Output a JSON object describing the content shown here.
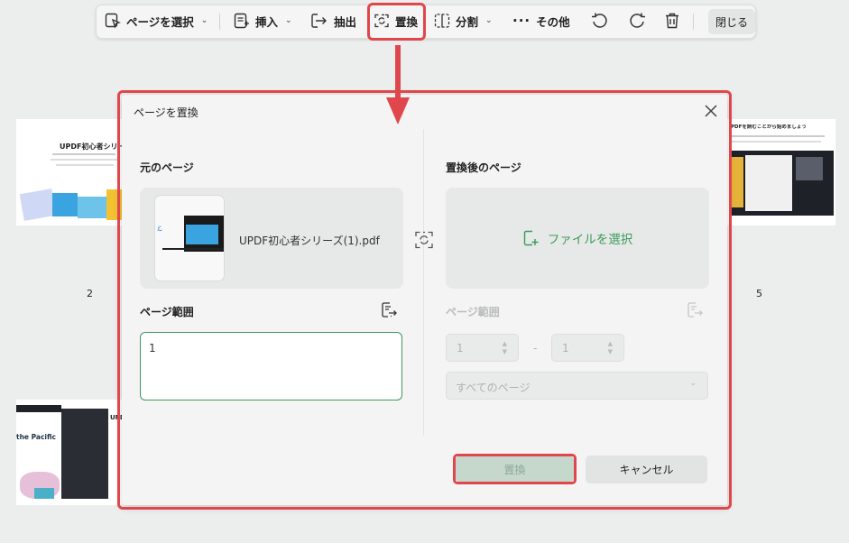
{
  "toolbar": {
    "select_pages": "ページを選択",
    "insert": "挿入",
    "extract": "抽出",
    "replace": "置換",
    "split": "分割",
    "more": "その他",
    "close": "閉じる"
  },
  "background": {
    "thumb_left_title": "UPDF初心者シリーズ",
    "thumb_bottom_title": "UPD",
    "thumb_bottom_caption": "the Pacific",
    "thumb_right_heading": "PDFを読むことから始めましょう",
    "page_number_left": "2",
    "page_number_right": "5"
  },
  "dialog": {
    "title": "ページを置換",
    "source": {
      "heading": "元のページ",
      "file_name": "UPDF初心者シリーズ(1).pdf",
      "range_label": "ページ範囲",
      "range_value": "1"
    },
    "target": {
      "heading": "置換後のページ",
      "select_file": "ファイルを選択",
      "range_label": "ページ範囲",
      "from": "1",
      "dash": "-",
      "to": "1",
      "dropdown": "すべてのページ"
    },
    "replace_button": "置換",
    "cancel_button": "キャンセル"
  },
  "colors": {
    "accent_green": "#3c9a5c",
    "highlight_red": "#e0474c"
  }
}
